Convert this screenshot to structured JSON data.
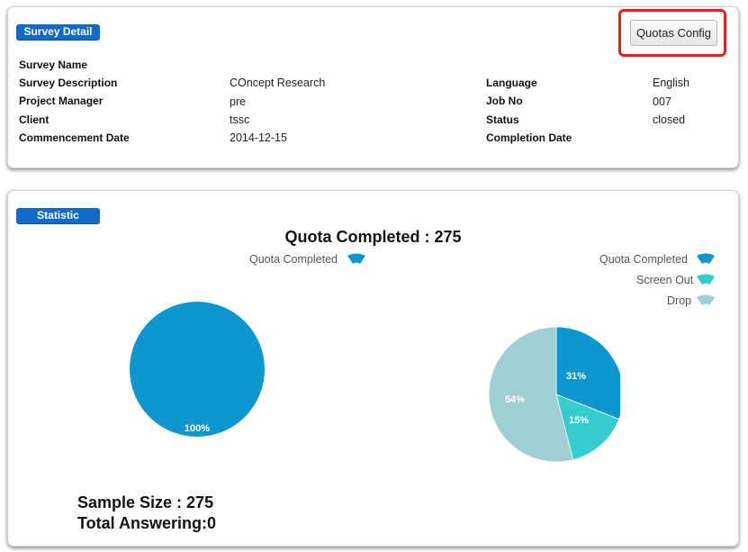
{
  "survey_detail": {
    "badge": "Survey Detail",
    "quotas_button": "Quotas Config",
    "fields": [
      {
        "label": "Survey Name",
        "value": ""
      },
      {
        "label": "Survey Description",
        "value": "COncept Research"
      },
      {
        "label": "Project Manager",
        "value": "pre"
      },
      {
        "label": "Client",
        "value": "tssc"
      },
      {
        "label": "Commencement Date",
        "value": "2014-12-15"
      },
      {
        "label": "Language",
        "value": "English"
      },
      {
        "label": "Job No",
        "value": "007"
      },
      {
        "label": "Status",
        "value": "closed"
      },
      {
        "label": "Completion Date",
        "value": ""
      }
    ]
  },
  "statistic": {
    "badge": "Statistic",
    "title": "Quota Completed : 275",
    "sample_size": "Sample Size : 275",
    "total_answering": "Total Answering:0"
  },
  "colors": {
    "quota_completed": "#0e97cf",
    "screen_out": "#34cccc",
    "drop": "#9fcfd4",
    "badge": "#0f6ac8",
    "highlight": "#e2231a"
  },
  "chart_data": [
    {
      "type": "pie",
      "legend": [
        "Quota Completed"
      ],
      "slices": [
        {
          "name": "Quota Completed",
          "value": 100,
          "label": "100%"
        }
      ],
      "legend_position": "top-right"
    },
    {
      "type": "pie",
      "legend": [
        "Quota Completed",
        "Screen Out",
        "Drop"
      ],
      "slices": [
        {
          "name": "Quota Completed",
          "value": 31,
          "label": "31%"
        },
        {
          "name": "Screen Out",
          "value": 15,
          "label": "15%"
        },
        {
          "name": "Drop",
          "value": 54,
          "label": "54%"
        }
      ],
      "legend_position": "top-right"
    }
  ]
}
